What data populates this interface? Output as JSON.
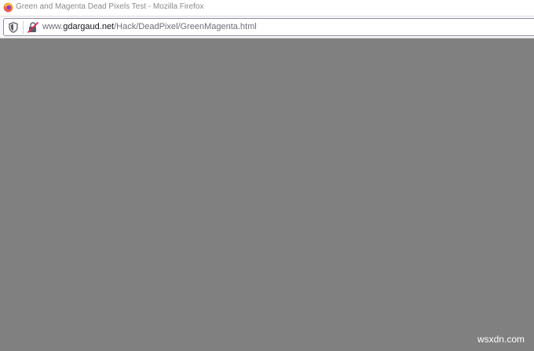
{
  "window": {
    "title": "Green and Magenta Dead Pixels Test - Mozilla Firefox"
  },
  "urlbar": {
    "url_prefix": "www.",
    "url_domain": "gdargaud.net",
    "url_path": "/Hack/DeadPixel/GreenMagenta.html"
  },
  "icons": {
    "browser": "firefox-logo-icon",
    "tracking_protection": "shield-icon",
    "connection": "insecure-connection-icon"
  },
  "page": {
    "background_color": "#808080"
  },
  "watermark": {
    "text": "wsxdn.com"
  }
}
